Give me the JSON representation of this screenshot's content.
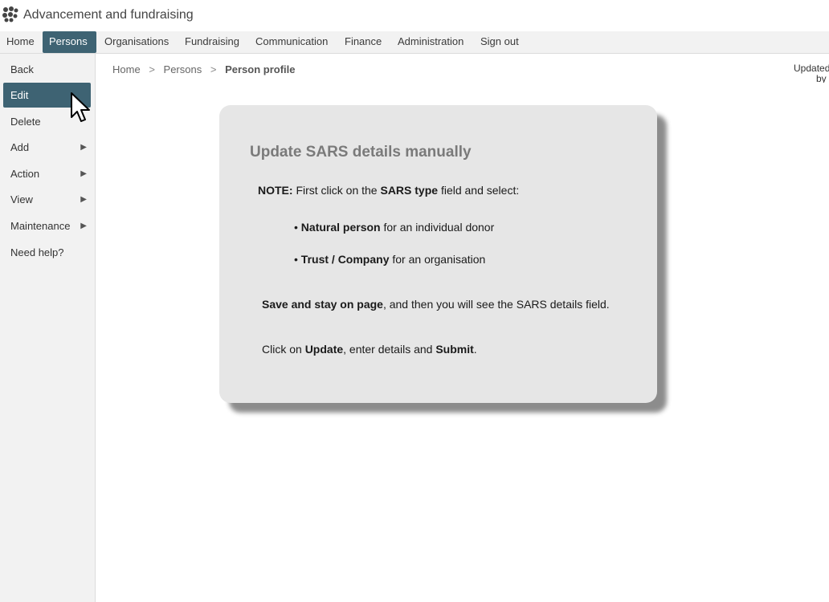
{
  "app": {
    "title": "Advancement and fundraising"
  },
  "menu": [
    {
      "label": "Home"
    },
    {
      "label": "Persons",
      "active": true
    },
    {
      "label": "Organisations"
    },
    {
      "label": "Fundraising"
    },
    {
      "label": "Communication"
    },
    {
      "label": "Finance"
    },
    {
      "label": "Administration"
    },
    {
      "label": "Sign out"
    }
  ],
  "sidebar": {
    "items": [
      {
        "label": "Back"
      },
      {
        "label": "Edit",
        "active": true
      },
      {
        "label": "Delete"
      },
      {
        "label": "Add",
        "submenu": true
      },
      {
        "label": "Action",
        "submenu": true
      },
      {
        "label": "View",
        "submenu": true
      },
      {
        "label": "Maintenance",
        "submenu": true
      },
      {
        "label": "Need help?"
      }
    ]
  },
  "breadcrumb": {
    "home": "Home",
    "persons": "Persons",
    "current": "Person profile",
    "separator": ">"
  },
  "updated": {
    "line1": "Updated",
    "line2": "by"
  },
  "help_card": {
    "title": "Update SARS details manually",
    "note_label": "NOTE:",
    "note_text_1": " First click on the ",
    "note_bold": "SARS type",
    "note_text_2": " field and select:",
    "bullet": "•",
    "bullet1_bold": "Natural person",
    "bullet1_text": " for an individual donor",
    "bullet2_bold": "Trust / Company",
    "bullet2_text": " for an organisation",
    "save_bold": "Save and stay on page",
    "save_text": ", and then you will see the SARS details field.",
    "click_text_1": "Click on ",
    "click_bold_1": "Update",
    "click_text_2": ", enter details and ",
    "click_bold_2": "Submit",
    "click_text_3": "."
  },
  "icons": {
    "logo": "app-logo-icon",
    "submenu": "triangle-right-icon",
    "cursor": "mouse-pointer-icon"
  },
  "colors": {
    "accent": "#3e6373",
    "card_bg": "#e6e6e6",
    "sidebar_bg": "#f2f2f2"
  }
}
